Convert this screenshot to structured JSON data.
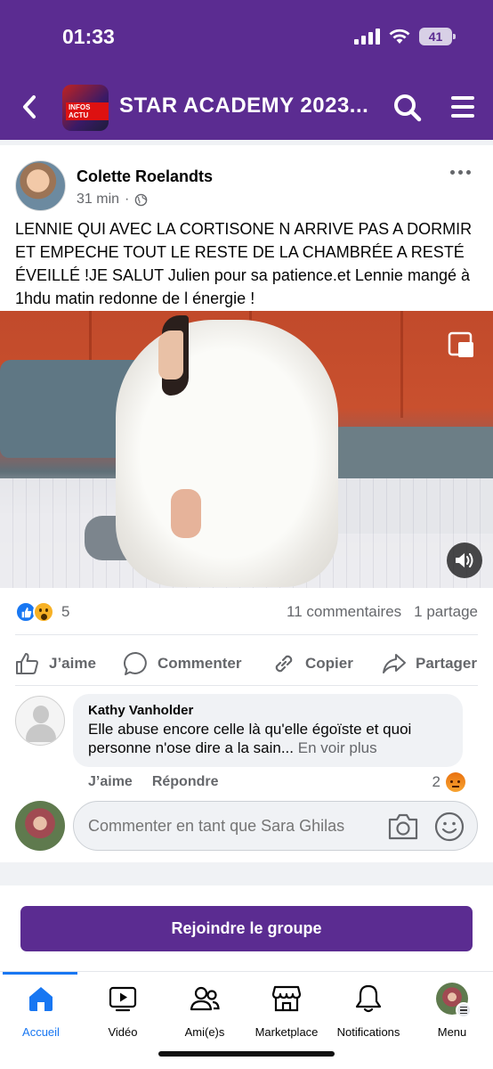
{
  "status_bar": {
    "time": "01:33",
    "battery": "41"
  },
  "header": {
    "title": "STAR ACADEMY 2023...",
    "thumb_label": "INFOS ACTU"
  },
  "post": {
    "author": "Colette Roelandts",
    "time": "31 min",
    "text": "LENNIE QUI AVEC LA CORTISONE N ARRIVE PAS A DORMIR ET EMPECHE TOUT LE RESTE DE LA CHAMBRÉE  A RESTÉ ÉVEILLÉ  !JE SALUT Julien pour sa patience.et Lennie mangé à 1hdu matin redonne de l énergie !",
    "reaction_count": "5",
    "comments_count": "11 commentaires",
    "shares_count": "1 partage",
    "actions": {
      "like": "J’aime",
      "comment": "Commenter",
      "copy": "Copier",
      "share": "Partager"
    }
  },
  "comment": {
    "author": "Kathy Vanholder",
    "text": "Elle abuse encore celle là qu'elle égoïste et quoi personne n'ose dire a la sain...",
    "see_more": "En voir plus",
    "like": "J’aime",
    "reply": "Répondre",
    "reaction_count": "2"
  },
  "compose": {
    "placeholder": "Commenter en tant que Sara Ghilas"
  },
  "join_button": "Rejoindre le groupe",
  "tabs": [
    {
      "label": "Accueil",
      "icon": "home-icon",
      "active": true
    },
    {
      "label": "Vidéo",
      "icon": "video-icon"
    },
    {
      "label": "Ami(e)s",
      "icon": "friends-icon"
    },
    {
      "label": "Marketplace",
      "icon": "marketplace-icon"
    },
    {
      "label": "Notifications",
      "icon": "bell-icon"
    },
    {
      "label": "Menu",
      "icon": "profile-avatar"
    }
  ],
  "colors": {
    "brand": "#5b2c91",
    "accent": "#1877f2",
    "muted": "#65676b"
  }
}
